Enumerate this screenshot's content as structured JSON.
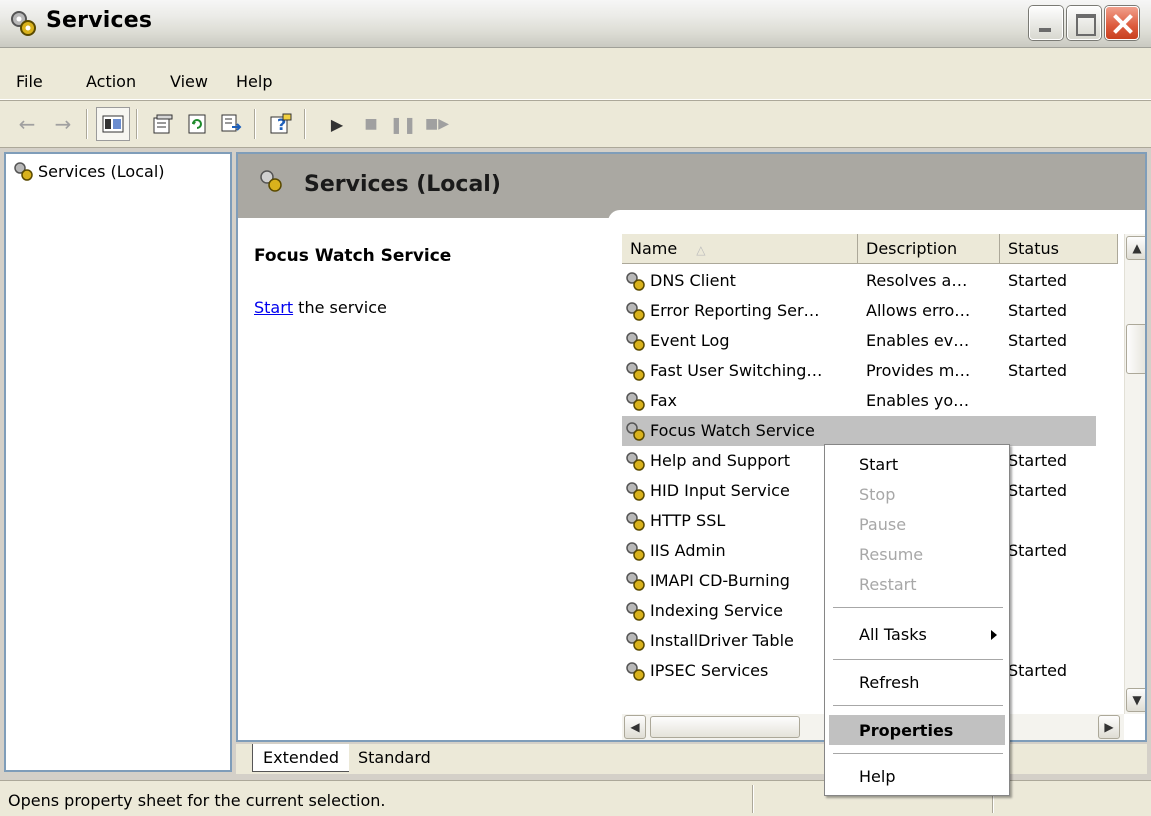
{
  "window": {
    "title": "Services"
  },
  "menubar": {
    "items": [
      "File",
      "Action",
      "View",
      "Help"
    ]
  },
  "toolbar": {
    "buttons": [
      "back-icon",
      "forward-icon",
      "show-hide-tree-icon",
      "properties-icon",
      "refresh-icon",
      "export-list-icon",
      "help-icon",
      "start-service-icon",
      "stop-service-icon",
      "pause-service-icon",
      "restart-service-icon"
    ]
  },
  "tree": {
    "root": "Services (Local)"
  },
  "header": {
    "title": "Services (Local)"
  },
  "detail": {
    "title": "Focus Watch Service",
    "link_text": "Start",
    "link_suffix": " the service"
  },
  "list": {
    "columns": [
      "Name",
      "Description",
      "Status"
    ],
    "rows": [
      {
        "name": "DNS Client",
        "description": "Resolves a…",
        "status": "Started"
      },
      {
        "name": "Error Reporting Ser…",
        "description": "Allows erro…",
        "status": "Started"
      },
      {
        "name": "Event Log",
        "description": "Enables ev…",
        "status": "Started"
      },
      {
        "name": "Fast User Switching…",
        "description": "Provides m…",
        "status": "Started"
      },
      {
        "name": "Fax",
        "description": "Enables yo…",
        "status": ""
      },
      {
        "name": "Focus Watch Service",
        "description": "",
        "status": ""
      },
      {
        "name": "Help and Support",
        "description": "",
        "status": "Started"
      },
      {
        "name": "HID Input Service",
        "description": "",
        "status": "Started"
      },
      {
        "name": "HTTP SSL",
        "description": "",
        "status": ""
      },
      {
        "name": "IIS Admin",
        "description": "",
        "status": "Started"
      },
      {
        "name": "IMAPI CD-Burning",
        "description": "",
        "status": ""
      },
      {
        "name": "Indexing Service",
        "description": "",
        "status": ""
      },
      {
        "name": "InstallDriver Table",
        "description": "",
        "status": ""
      },
      {
        "name": "IPSEC Services",
        "description": "",
        "status": "Started"
      }
    ]
  },
  "tabs": [
    "Extended",
    "Standard"
  ],
  "status": {
    "text": "Opens property sheet for the current selection."
  },
  "context_menu": {
    "start": "Start",
    "stop": "Stop",
    "pause": "Pause",
    "resume": "Resume",
    "restart": "Restart",
    "all_tasks": "All Tasks",
    "refresh": "Refresh",
    "properties": "Properties",
    "help": "Help"
  },
  "colors": {
    "selection": "#c1c1c1",
    "header_band": "#aaa8a2",
    "link": "#0000ee"
  }
}
